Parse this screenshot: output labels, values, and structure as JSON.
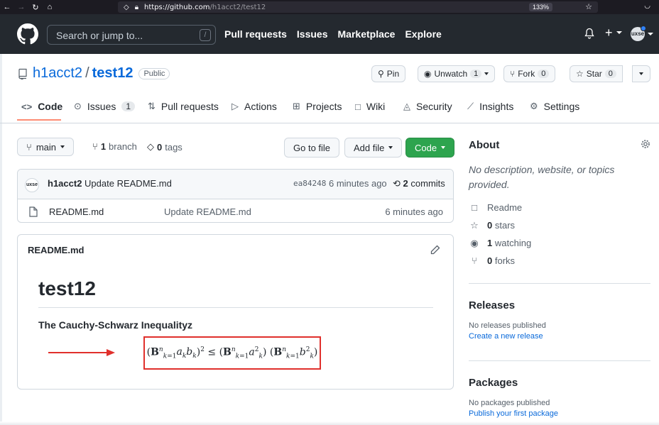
{
  "browser": {
    "url_host": "https://github.com",
    "url_path": "/h1acct2/test12",
    "zoom": "133%"
  },
  "header": {
    "search_placeholder": "Search or jump to...",
    "search_key": "/",
    "nav": [
      "Pull requests",
      "Issues",
      "Marketplace",
      "Explore"
    ],
    "avatar_text": "uxse"
  },
  "repo": {
    "owner": "h1acct2",
    "separator": "/",
    "name": "test12",
    "visibility": "Public",
    "pin_label": "Pin",
    "unwatch_label": "Unwatch",
    "unwatch_count": "1",
    "fork_label": "Fork",
    "fork_count": "0",
    "star_label": "Star",
    "star_count": "0"
  },
  "tabs": [
    {
      "label": "Code",
      "icon": "code-icon"
    },
    {
      "label": "Issues",
      "count": "1",
      "icon": "issue-icon"
    },
    {
      "label": "Pull requests",
      "icon": "pull-request-icon"
    },
    {
      "label": "Actions",
      "icon": "play-icon"
    },
    {
      "label": "Projects",
      "icon": "table-icon"
    },
    {
      "label": "Wiki",
      "icon": "book-icon"
    },
    {
      "label": "Security",
      "icon": "shield-icon"
    },
    {
      "label": "Insights",
      "icon": "graph-icon"
    },
    {
      "label": "Settings",
      "icon": "gear-icon"
    }
  ],
  "branchbar": {
    "branch": "main",
    "branch_count": "1",
    "branch_word": "branch",
    "tag_count": "0",
    "tag_word": "tags",
    "go_to_file": "Go to file",
    "add_file": "Add file",
    "code": "Code"
  },
  "commit": {
    "avatar_text": "uxse",
    "author": "h1acct2",
    "message": "Update README.md",
    "sha": "ea84248",
    "ago": "6 minutes ago",
    "commit_count": "2",
    "commit_word": "commits"
  },
  "files": [
    {
      "name": "README.md",
      "message": "Update README.md",
      "ago": "6 minutes ago"
    }
  ],
  "readme": {
    "header": "README.md",
    "h1": "test12",
    "h3": "The Cauchy-Schwarz Inequalityz"
  },
  "about": {
    "title": "About",
    "description": "No description, website, or topics provided.",
    "readme_label": "Readme",
    "stars_count": "0",
    "stars_word": "stars",
    "watching_count": "1",
    "watching_word": "watching",
    "forks_count": "0",
    "forks_word": "forks"
  },
  "releases": {
    "title": "Releases",
    "empty": "No releases published",
    "link": "Create a new release"
  },
  "packages": {
    "title": "Packages",
    "empty": "No packages published",
    "link": "Publish your first package"
  },
  "colors": {
    "accent_blue": "#0969da",
    "green_button": "#2da44e",
    "annotation_red": "#e0302c",
    "header_dark": "#24292f"
  }
}
